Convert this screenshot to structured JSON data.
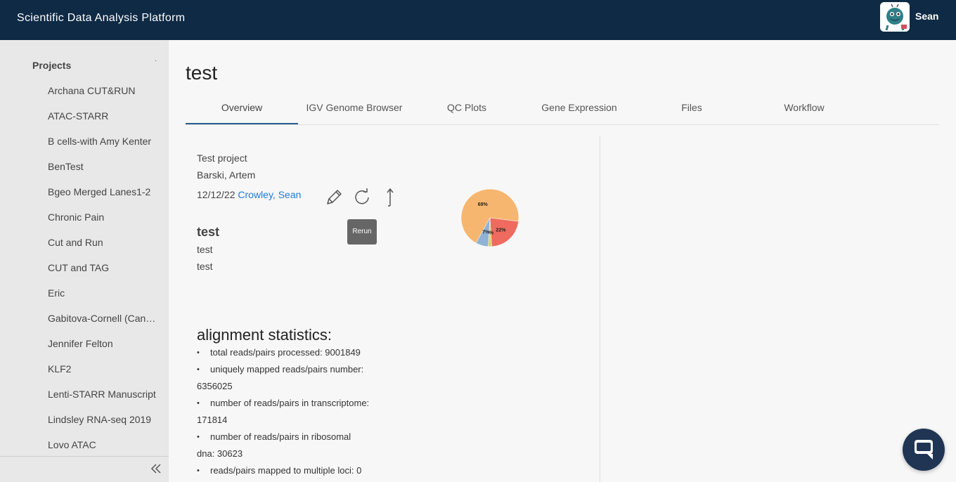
{
  "app": {
    "title": "Scientific Data Analysis Platform"
  },
  "user": {
    "name": "Sean"
  },
  "sidebar": {
    "heading": "Projects",
    "marker": "·",
    "items": [
      "Archana CUT&RUN",
      "ATAC-STARR",
      "B cells-with Amy Kenter",
      "BenTest",
      "Bgeo Merged Lanes1-2",
      "Chronic Pain",
      "Cut and Run",
      "CUT and TAG",
      "Eric",
      "Gabitova-Cornell (Cancer)",
      "Jennifer Felton",
      "KLF2",
      "Lenti-STARR Manuscript",
      "Lindsley RNA-seq 2019",
      "Lovo ATAC"
    ]
  },
  "page": {
    "title": "test"
  },
  "tabs": [
    "Overview",
    "IGV Genome Browser",
    "QC Plots",
    "Gene Expression",
    "Files",
    "Workflow"
  ],
  "overview": {
    "project_name": "Test project",
    "pi": "Barski, Artem",
    "date": "12/12/22",
    "author": "Crowley, Sean",
    "tooltip": "Rerun",
    "sample_title": "test",
    "sample_lines": [
      "test",
      "test"
    ]
  },
  "pie": {
    "labels": [
      "69%",
      "22%",
      "2%",
      "7%"
    ],
    "values": [
      69,
      22,
      2,
      7
    ],
    "colors": [
      "#f6b66f",
      "#ef6b5f",
      "#dcd16a",
      "#8fb2d6"
    ]
  },
  "stats": {
    "title": "alignment statistics:",
    "items": [
      {
        "label": "total reads/pairs processed: 9001849"
      },
      {
        "label": "uniquely mapped reads/pairs number:",
        "value": "6356025"
      },
      {
        "label": "number of reads/pairs in transcriptome:",
        "value": "171814"
      },
      {
        "label": "number of reads/pairs in ribosomal",
        "value": "dna: 30623"
      },
      {
        "label": "reads/pairs mapped to multiple loci: 0"
      }
    ]
  },
  "icons": {
    "edit": "pencil-icon",
    "rerun": "refresh-icon",
    "share": "arrow-up-icon",
    "collapse": "double-chevron-left-icon",
    "chat": "chat-icon"
  }
}
